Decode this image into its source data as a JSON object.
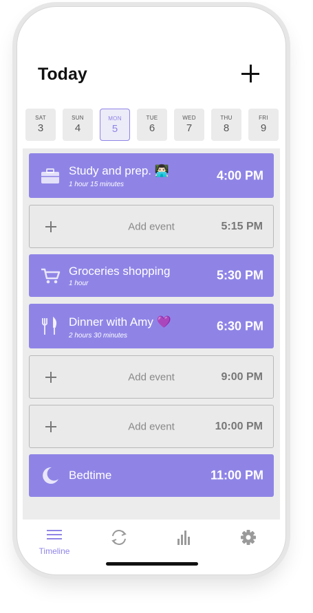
{
  "header": {
    "title": "Today"
  },
  "days": [
    {
      "name": "SAT",
      "date": "3",
      "selected": false
    },
    {
      "name": "SUN",
      "date": "4",
      "selected": false
    },
    {
      "name": "MON",
      "date": "5",
      "selected": true
    },
    {
      "name": "TUE",
      "date": "6",
      "selected": false
    },
    {
      "name": "WED",
      "date": "7",
      "selected": false
    },
    {
      "name": "THU",
      "date": "8",
      "selected": false
    },
    {
      "name": "FRI",
      "date": "9",
      "selected": false
    }
  ],
  "events": [
    {
      "type": "event",
      "name": "Study and prep. 👨🏻‍💻",
      "duration": "1 hour 15 minutes",
      "time": "4:00 PM",
      "icon": "briefcase-icon"
    },
    {
      "type": "empty",
      "label": "Add event",
      "time": "5:15 PM"
    },
    {
      "type": "event",
      "name": "Groceries shopping",
      "duration": "1 hour",
      "time": "5:30 PM",
      "icon": "shopping-cart-icon"
    },
    {
      "type": "event",
      "name": "Dinner with Amy 💜",
      "duration": "2 hours 30 minutes",
      "time": "6:30 PM",
      "icon": "fork-knife-icon"
    },
    {
      "type": "empty",
      "label": "Add event",
      "time": "9:00 PM"
    },
    {
      "type": "empty",
      "label": "Add event",
      "time": "10:00 PM"
    },
    {
      "type": "event",
      "name": "Bedtime",
      "duration": "",
      "time": "11:00 PM",
      "icon": "moon-icon"
    }
  ],
  "tabs": [
    {
      "label": "Timeline",
      "icon": "menu-lines-icon",
      "active": true
    },
    {
      "label": "",
      "icon": "sync-icon",
      "active": false
    },
    {
      "label": "",
      "icon": "bar-chart-icon",
      "active": false
    },
    {
      "label": "",
      "icon": "gear-icon",
      "active": false
    }
  ],
  "colors": {
    "accent": "#8f84e6",
    "background": "#ececec"
  }
}
